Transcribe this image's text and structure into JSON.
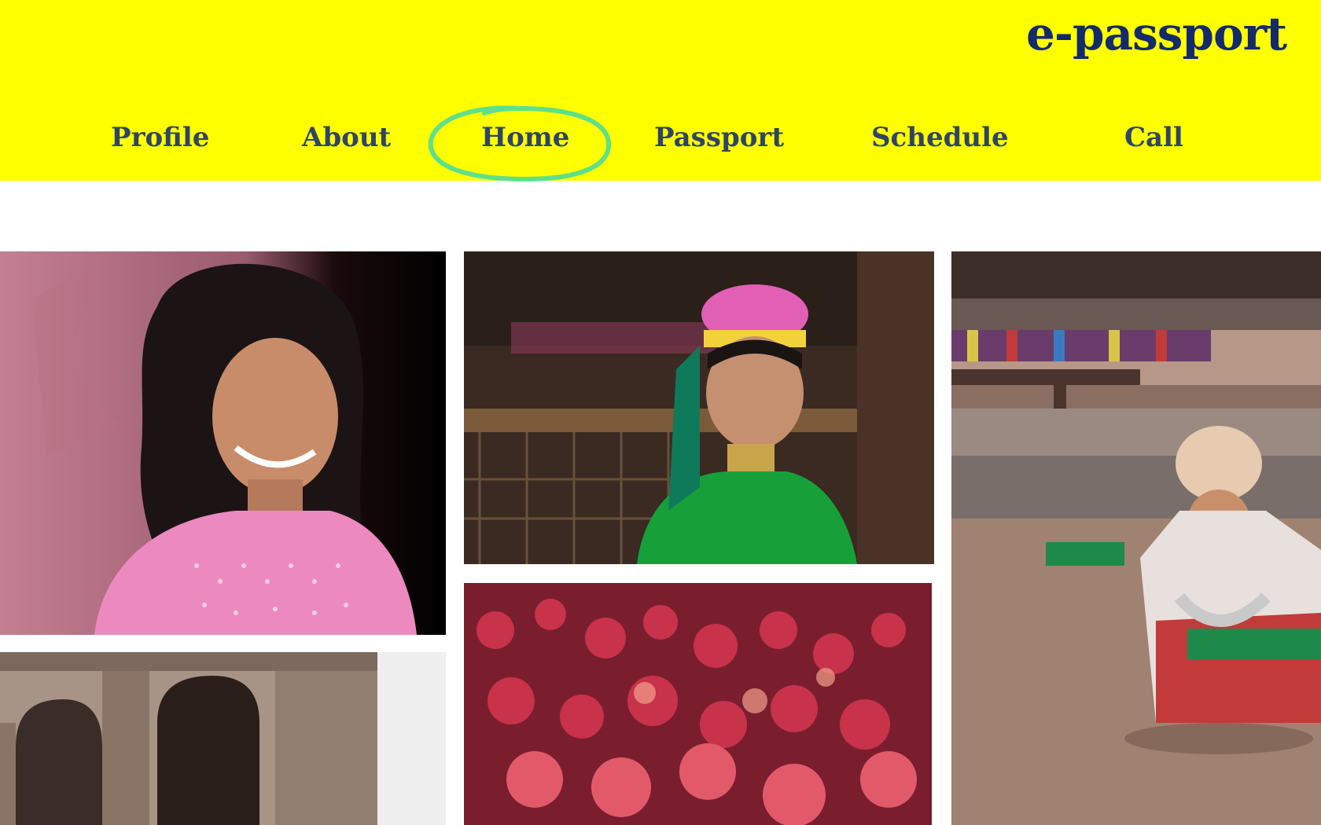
{
  "header": {
    "brand": "e-passport",
    "background_color": "#ffff00",
    "brand_color": "#132a6b",
    "nav_text_color": "#2f4468",
    "highlight_color": "#5ee08a"
  },
  "nav": {
    "items": [
      {
        "label": "Profile"
      },
      {
        "label": "About"
      },
      {
        "label": "Home",
        "highlighted": true
      },
      {
        "label": "Passport"
      },
      {
        "label": "Schedule"
      },
      {
        "label": "Call"
      }
    ]
  },
  "gallery": {
    "photos": [
      {
        "subject": "smiling girl in pink polka-dot dress"
      },
      {
        "subject": "child with pink headdress and green scarf"
      },
      {
        "subject": "child in traditional costume with turban"
      },
      {
        "subject": "ancient stone arches"
      },
      {
        "subject": "crowd covered in red and pink color powder"
      }
    ]
  }
}
